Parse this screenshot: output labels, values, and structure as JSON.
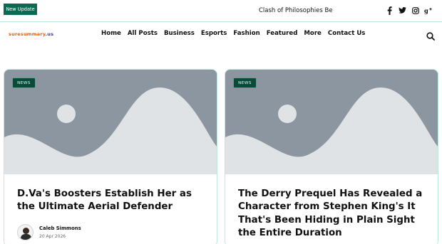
{
  "topbar": {
    "update_badge": "New Update",
    "ticker_text": "Clash of Philosophies Be",
    "social_icons": [
      "facebook-icon",
      "twitter-icon",
      "instagram-icon",
      "google-plus-icon"
    ]
  },
  "nav": {
    "logo_part1": "suresummary",
    "logo_part2": ".us",
    "items": [
      {
        "label": "Home"
      },
      {
        "label": "All Posts"
      },
      {
        "label": "Business"
      },
      {
        "label": "Esports"
      },
      {
        "label": "Fashion"
      },
      {
        "label": "Featured"
      },
      {
        "label": "More"
      },
      {
        "label": "Contact Us"
      }
    ],
    "search_icon": "search-icon"
  },
  "posts": [
    {
      "category": "NEWS",
      "title": "D.Va's Boosters Establish Her as the Ultimate Aerial Defender",
      "author": "Caleb Simmons",
      "date": "20 Apr 2026"
    },
    {
      "category": "NEWS",
      "title": "The Derry Prequel Has Revealed a Character from Stephen King's It That's Been Hiding in Plain Sight the Entire Duration"
    }
  ],
  "colors": {
    "badge_green": "#0b6a52",
    "accent_border": "#bfe8dc",
    "placeholder_bg": "#8c96a1",
    "placeholder_shape": "#dfe3e6",
    "logo_orange": "#e85a0c",
    "logo_blue": "#2f3aa8"
  }
}
